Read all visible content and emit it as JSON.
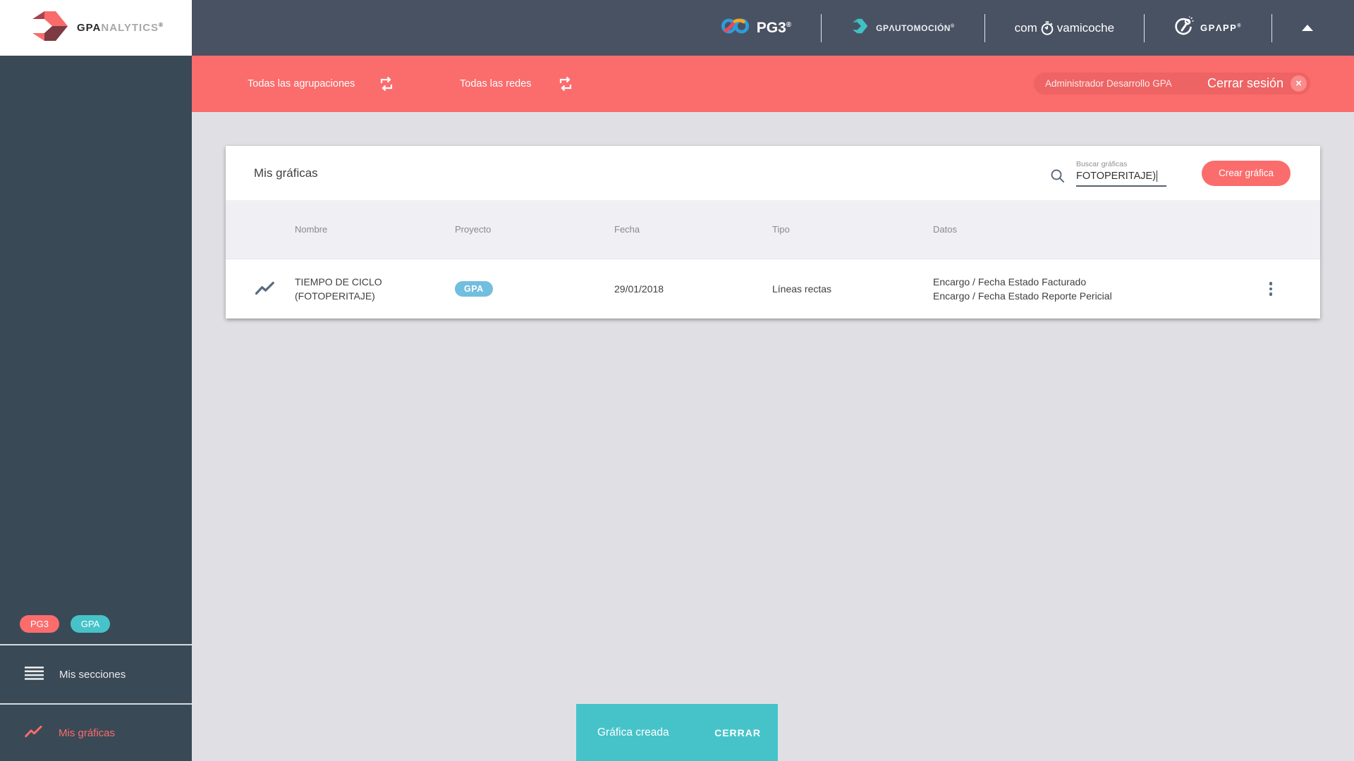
{
  "header": {
    "brand": {
      "gpa": "GPA",
      "nalytics": "NALYTICS",
      "reg": "®"
    },
    "logos": {
      "pg3": {
        "text": "PG3",
        "reg": "®"
      },
      "gpautomocion": {
        "text": "GPΛUTOMOCIÓN",
        "reg": "®"
      },
      "comprova": {
        "pre": "com",
        "post": "vamicoche"
      },
      "gpapp": {
        "text": "GPΛPP",
        "reg": "®"
      }
    }
  },
  "filterbar": {
    "agrupaciones_label": "Todas las agrupaciones",
    "redes_label": "Todas las redes",
    "user_label": "Administrador Desarrollo GPA",
    "logout_label": "Cerrar sesión",
    "close_glyph": "×"
  },
  "sidebar": {
    "badges": [
      {
        "label": "PG3",
        "color": "#fb6c6c"
      },
      {
        "label": "GPA",
        "color": "#46c3c9"
      }
    ],
    "items": [
      {
        "label": "Mis secciones",
        "active": false
      },
      {
        "label": "Mis gráficas",
        "active": true
      }
    ]
  },
  "main": {
    "card": {
      "title": "Mis gráficas",
      "search": {
        "label": "Buscar gráficas",
        "value": "FOTOPERITAJE)"
      },
      "create_button": "Crear gráfica",
      "table": {
        "columns": [
          "Nombre",
          "Proyecto",
          "Fecha",
          "Tipo",
          "Datos"
        ],
        "rows": [
          {
            "nombre": "TIEMPO DE CICLO (FOTOPERITAJE)",
            "proyecto": "GPA",
            "fecha": "29/01/2018",
            "tipo": "Líneas rectas",
            "datos": [
              "Encargo / Fecha Estado Facturado",
              "Encargo / Fecha Estado Reporte Pericial"
            ]
          }
        ]
      }
    }
  },
  "snackbar": {
    "message": "Gráfica creada",
    "action": "CERRAR"
  },
  "icons": {
    "brand": "gpa-arrow",
    "pg3": "infinity",
    "gpautomocion": "teal-arrow",
    "comprova": "stopwatch",
    "gpapp": "wrench-circle",
    "filter_swap": "repeat-arrows",
    "search": "magnifier",
    "row_type": "line-chart",
    "row_menu": "kebab-vertical",
    "sections": "list-lines",
    "collapse": "caret-up"
  },
  "colors": {
    "accent_coral": "#fb6c6c",
    "accent_teal": "#46c3c9",
    "badge_blue": "#72bede",
    "header_bg": "#495263",
    "sidebar_bg": "#3a4956",
    "main_bg": "#e0e0e4"
  }
}
